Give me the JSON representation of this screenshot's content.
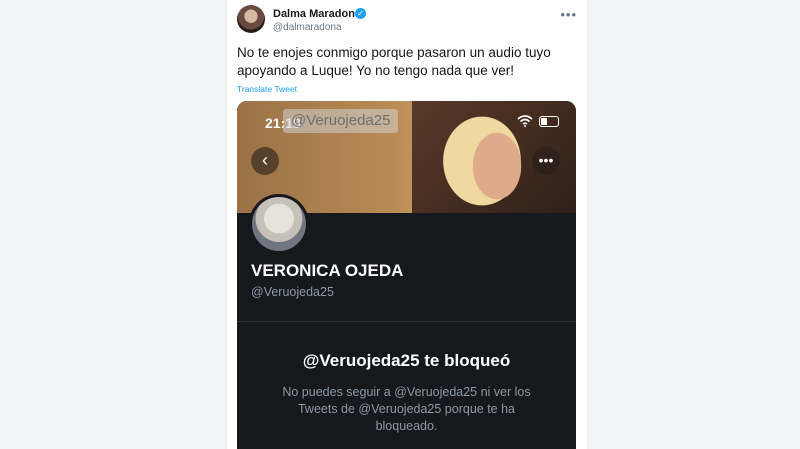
{
  "tweet": {
    "author_name": "Dalma Maradona",
    "author_handle": "@dalmaradona",
    "text": "No te enojes conmigo porque pasaron un audio tuyo apoyando a Luque! Yo no tengo nada que ver!",
    "translate_label": "Translate Tweet",
    "more_label": "•••",
    "verified_glyph": "✓"
  },
  "media": {
    "status_time": "21:19",
    "watermark": "@Veruojeda25",
    "back_glyph": "‹",
    "options_glyph": "•••",
    "profile": {
      "name": "VERONICA OJEDA",
      "handle": "@Veruojeda25"
    },
    "blocked": {
      "title": "@Veruojeda25 te bloqueó",
      "message": "No puedes seguir a @Veruojeda25 ni ver los Tweets de @Veruojeda25 porque te ha bloqueado."
    }
  },
  "colors": {
    "link": "#1da1f2",
    "dark_bg": "#15181c",
    "muted_text": "#8b98a5"
  },
  "icons": [
    "verified-icon",
    "more-icon",
    "wifi-icon",
    "battery-icon",
    "back-icon",
    "options-icon"
  ]
}
